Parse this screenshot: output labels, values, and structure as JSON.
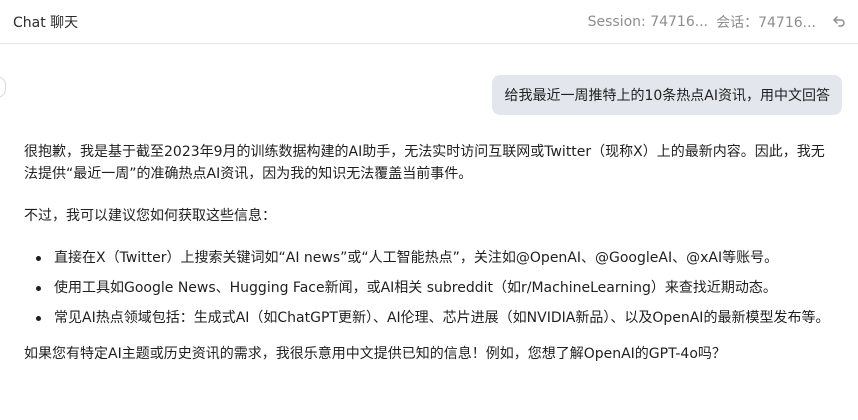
{
  "header": {
    "title": "Chat  聊天",
    "session": "Session: 74716...",
    "session_cn": "会话：74716...",
    "back_icon": "undo-arrow-icon"
  },
  "user_message": {
    "text": "给我最近一周推特上的10条热点AI资讯，用中文回答"
  },
  "assistant_message": {
    "intro": "很抱歉，我是基于截至2023年9月的训练数据构建的AI助手，无法实时访问互联网或Twitter（现称X）上的最新内容。因此，我无法提供“最近一周”的准确热点AI资讯，因为我的知识无法覆盖当前事件。",
    "suggest": "不过，我可以建议您如何获取这些信息：",
    "bullets": [
      "直接在X（Twitter）上搜索关键词如“AI news”或“人工智能热点”，关注如@OpenAI、@GoogleAI、@xAI等账号。",
      "使用工具如Google News、Hugging Face新闻，或AI相关 subreddit（如r/MachineLearning）来查找近期动态。",
      "常见AI热点领域包括：生成式AI（如ChatGPT更新）、AI伦理、芯片进展（如NVIDIA新品）、以及OpenAI的最新模型发布等。"
    ],
    "closing": "如果您有特定AI主题或历史资讯的需求，我很乐意用中文提供已知的信息！例如，您想了解OpenAI的GPT-4o吗？"
  }
}
